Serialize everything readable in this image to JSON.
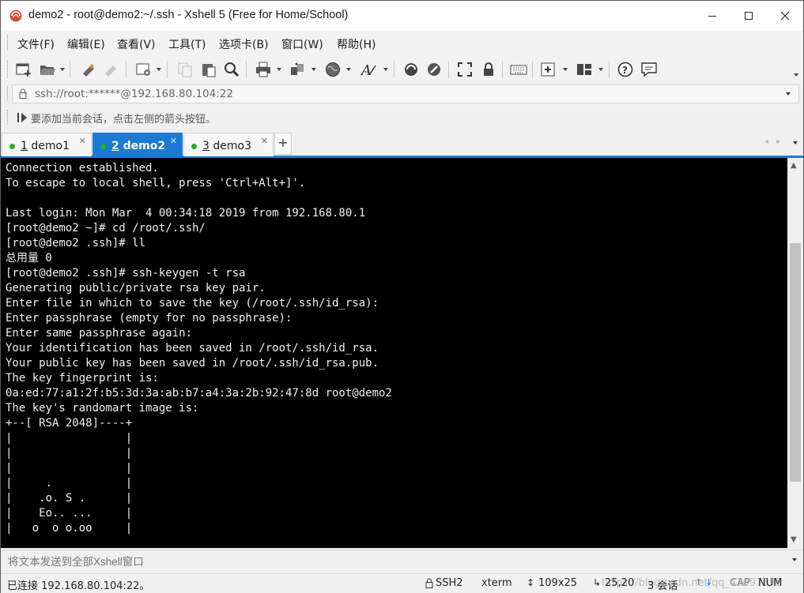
{
  "window": {
    "title": "demo2 - root@demo2:~/.ssh - Xshell 5 (Free for Home/School)",
    "accent_color": "#1a7bd5",
    "session_dot_color": "#1fb31f"
  },
  "menu": {
    "items": [
      {
        "label": "文件(F)",
        "icon": "file-menu"
      },
      {
        "label": "编辑(E)",
        "icon": "edit-menu"
      },
      {
        "label": "查看(V)",
        "icon": "view-menu"
      },
      {
        "label": "工具(T)",
        "icon": "tools-menu"
      },
      {
        "label": "选项卡(B)",
        "icon": "tabs-menu"
      },
      {
        "label": "窗口(W)",
        "icon": "window-menu"
      },
      {
        "label": "帮助(H)",
        "icon": "help-menu"
      }
    ]
  },
  "toolbar": {
    "icons": [
      "new-session-icon",
      "open-folder-icon",
      "reconnect-icon",
      "disconnect-icon",
      "properties-icon",
      "copy-icon",
      "paste-icon",
      "find-icon",
      "print-icon",
      "transfer-icon",
      "globe-icon",
      "font-icon",
      "xftp-icon",
      "script-icon",
      "fullscreen-icon",
      "lock-icon",
      "keyboard-icon",
      "new-tab-icon",
      "layout-icon",
      "help-icon",
      "chat-icon"
    ]
  },
  "address": {
    "value": "ssh://root:******@192.168.80.104:22"
  },
  "hint": {
    "text": "要添加当前会话，点击左侧的箭头按钮。"
  },
  "tabs": [
    {
      "number": "1",
      "name": " demo1",
      "active": false
    },
    {
      "number": "2",
      "name": " demo2",
      "active": true
    },
    {
      "number": "3",
      "name": " demo3",
      "active": false
    }
  ],
  "terminal": {
    "lines": [
      "Connection established.",
      "To escape to local shell, press 'Ctrl+Alt+]'.",
      "",
      "Last login: Mon Mar  4 00:34:18 2019 from 192.168.80.1",
      "[root@demo2 ~]# cd /root/.ssh/",
      "[root@demo2 .ssh]# ll",
      "总用量 0",
      "[root@demo2 .ssh]# ssh-keygen -t rsa",
      "Generating public/private rsa key pair.",
      "Enter file in which to save the key (/root/.ssh/id_rsa):",
      "Enter passphrase (empty for no passphrase):",
      "Enter same passphrase again:",
      "Your identification has been saved in /root/.ssh/id_rsa.",
      "Your public key has been saved in /root/.ssh/id_rsa.pub.",
      "The key fingerprint is:",
      "0a:ed:77:a1:2f:b5:3d:3a:ab:b7:a4:3a:2b:92:47:8d root@demo2",
      "The key's randomart image is:",
      "+--[ RSA 2048]----+",
      "|                 |",
      "|                 |",
      "|                 |",
      "|     .           |",
      "|    .o. S .      |",
      "|    Eo.. ...     |",
      "|   o  o o.oo     |"
    ]
  },
  "sendbar": {
    "placeholder": "将文本发送到全部Xshell窗口"
  },
  "status": {
    "connection": "已连接 192.168.80.104:22。",
    "protocol": "SSH2",
    "terminal_type": "xterm",
    "size": "109x25",
    "cursor": "25,20",
    "sessions": "3 会话",
    "cap": "CAP",
    "num": "NUM",
    "watermark": "https://blog.csdn.net/qq_43097595"
  }
}
